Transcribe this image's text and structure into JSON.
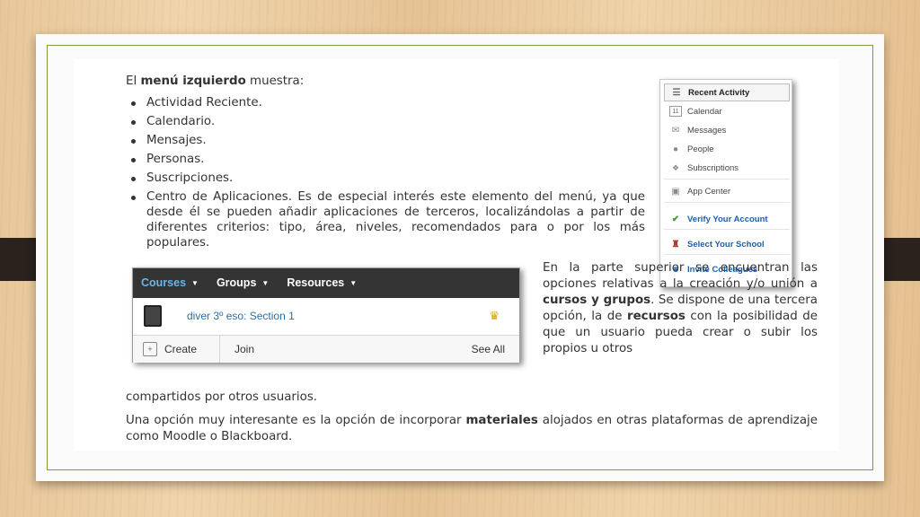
{
  "intro": {
    "prefix": "El ",
    "bold": "menú izquierdo",
    "suffix": " muestra:"
  },
  "menu_items": [
    "Actividad Reciente.",
    "Calendario.",
    "Mensajes.",
    "Personas.",
    "Suscripciones.",
    "Centro de Aplicaciones. Es de especial interés este elemento del menú, ya que desde él se pueden añadir aplicaciones de terceros, localizándolas a partir de diferentes criterios: tipo, área, niveles, recomendados para o por los más populares."
  ],
  "left_menu": {
    "recent_activity": "Recent Activity",
    "calendar": "Calendar",
    "calendar_icon_day": "11",
    "messages": "Messages",
    "people": "People",
    "subscriptions": "Subscriptions",
    "app_center": "App Center",
    "verify_account": "Verify Your Account",
    "select_school": "Select Your School",
    "invite_colleagues": "Invite Colleagues"
  },
  "courses_widget": {
    "tab_courses": "Courses",
    "tab_groups": "Groups",
    "tab_resources": "Resources",
    "course_name": "diver 3º eso: Section 1",
    "create": "Create",
    "join": "Join",
    "see_all": "See All"
  },
  "paragraph_side": {
    "part1": "En la parte superior se encuentran las opciones relativas a la creación y/o unión a ",
    "bold1": "cursos y grupos",
    "part2": ". Se dispone de una tercera opción, la de ",
    "bold2": "recursos",
    "part3": " con la posibilidad de que un usuario pueda crear o subir los propios u otros"
  },
  "paragraph_tail": "compartidos por otros usuarios.",
  "paragraph_end": {
    "part1": "Una opción muy interesante es la opción de incorporar ",
    "bold": "materiales",
    "part2": " alojados en otras plataformas de aprendizaje como Moodle o Blackboard."
  },
  "colors": {
    "frame_green": "#7f9a3c",
    "strap": "#2b211d",
    "link_blue": "#1f5fa8",
    "active_tab": "#6bb4e8"
  }
}
